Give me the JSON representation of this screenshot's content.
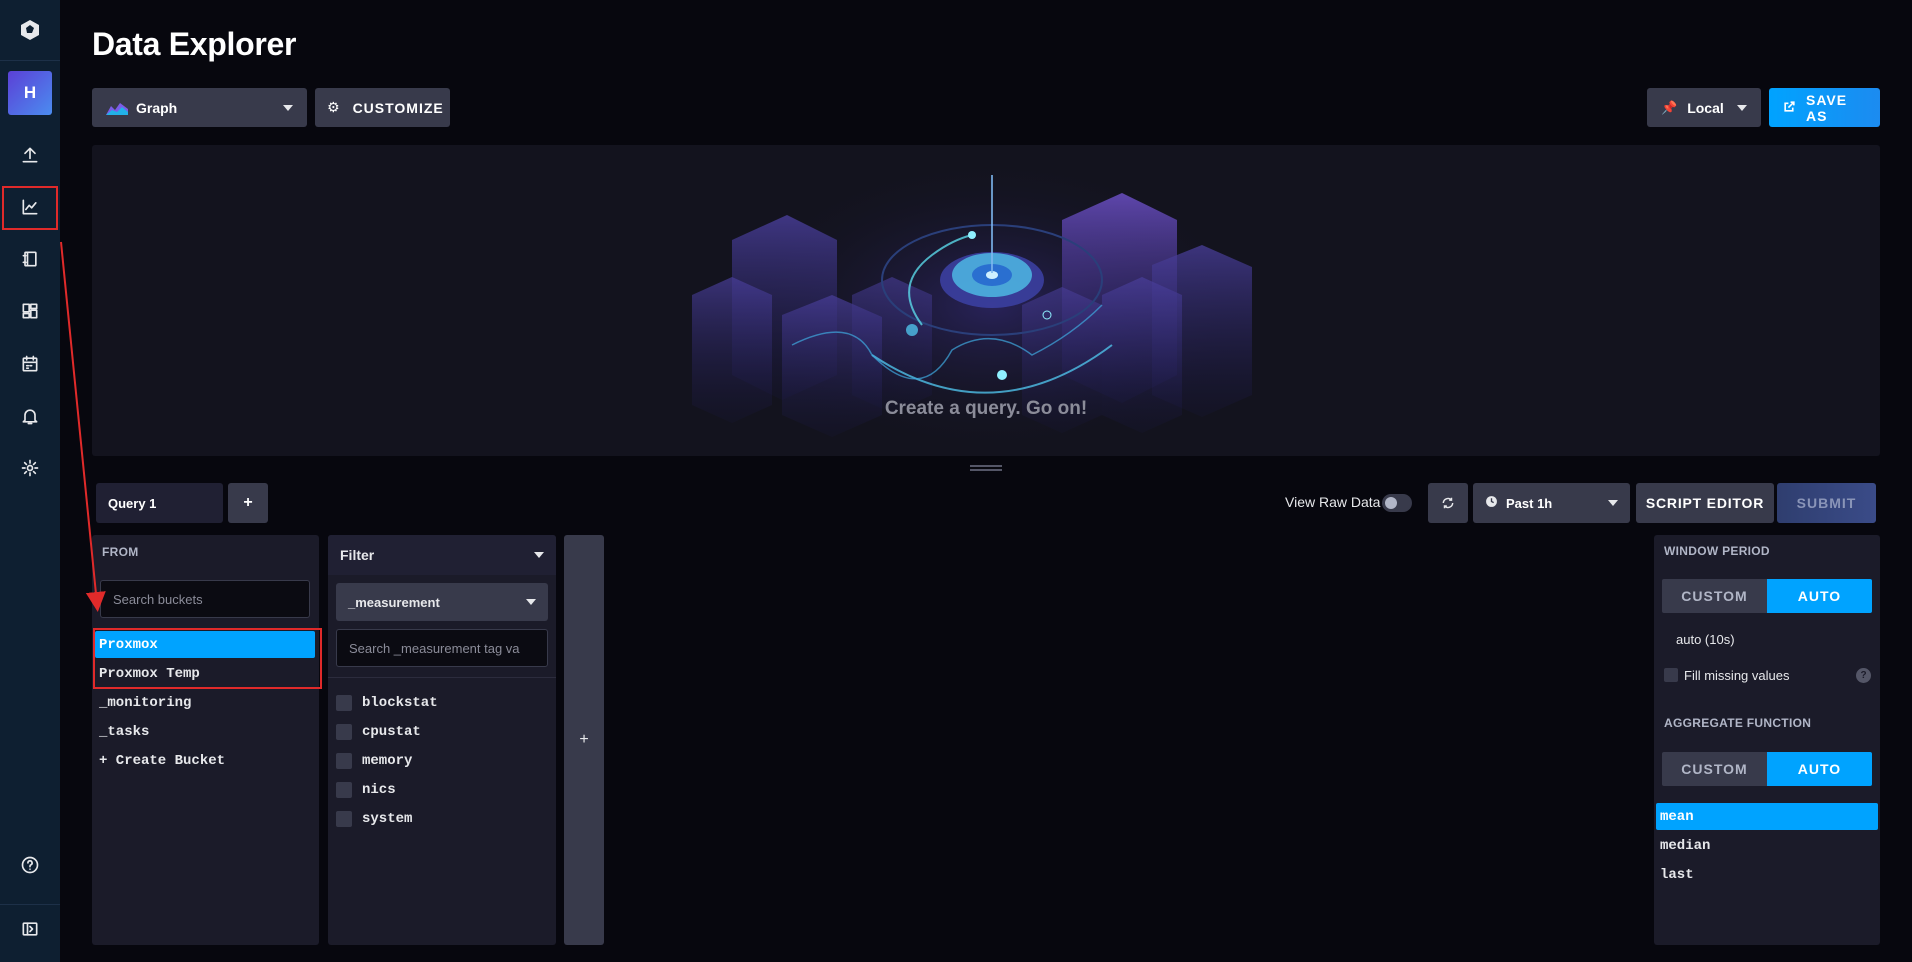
{
  "header": {
    "title": "Data Explorer"
  },
  "sidebar": {
    "avatar_letter": "H",
    "items": [
      "logo-icon",
      "upload-icon",
      "data-explorer-icon",
      "notebook-icon",
      "dashboards-icon",
      "tasks-icon",
      "alerts-icon",
      "settings-icon",
      "help-icon",
      "collapse-icon"
    ]
  },
  "toolbar": {
    "graph_label": "Graph",
    "customize_label": "CUSTOMIZE",
    "timezone_label": "Local",
    "save_as_label": "SAVE AS"
  },
  "graph_area": {
    "empty_message": "Create a query. Go on!"
  },
  "query_bar": {
    "query_tab_label": "Query 1",
    "add_query_label": "+",
    "view_raw_label": "View Raw Data",
    "view_raw_on": false,
    "time_range_label": "Past 1h",
    "script_editor_label": "SCRIPT EDITOR",
    "submit_label": "SUBMIT"
  },
  "from_panel": {
    "title": "FROM",
    "search_placeholder": "Search buckets",
    "buckets": [
      "Proxmox",
      "Proxmox Temp",
      "_monitoring",
      "_tasks",
      "+ Create Bucket"
    ],
    "selected_bucket": "Proxmox"
  },
  "filter_panel": {
    "title": "Filter",
    "key_label": "_measurement",
    "search_placeholder": "Search _measurement tag va",
    "tags": [
      "blockstat",
      "cpustat",
      "memory",
      "nics",
      "system"
    ],
    "add_label": "+"
  },
  "window_panel": {
    "window_title": "WINDOW PERIOD",
    "custom_label": "CUSTOM",
    "auto_label": "AUTO",
    "period_value": "auto (10s)",
    "fill_missing_label": "Fill missing values",
    "aggregate_title": "AGGREGATE FUNCTION",
    "functions": [
      "mean",
      "median",
      "last"
    ],
    "selected_function": "mean"
  },
  "colors": {
    "accent": "#00a3ff",
    "annotation": "#e02a2a",
    "sidebar": "#0e1f31"
  }
}
